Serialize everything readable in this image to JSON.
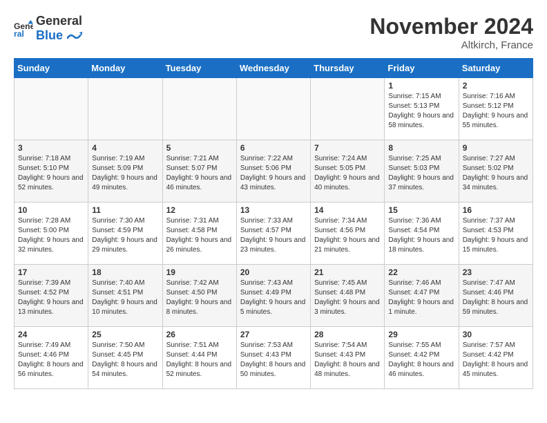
{
  "logo": {
    "line1": "General",
    "line2": "Blue"
  },
  "title": "November 2024",
  "subtitle": "Altkirch, France",
  "days_header": [
    "Sunday",
    "Monday",
    "Tuesday",
    "Wednesday",
    "Thursday",
    "Friday",
    "Saturday"
  ],
  "weeks": [
    [
      {
        "day": "",
        "info": ""
      },
      {
        "day": "",
        "info": ""
      },
      {
        "day": "",
        "info": ""
      },
      {
        "day": "",
        "info": ""
      },
      {
        "day": "",
        "info": ""
      },
      {
        "day": "1",
        "info": "Sunrise: 7:15 AM\nSunset: 5:13 PM\nDaylight: 9 hours and 58 minutes."
      },
      {
        "day": "2",
        "info": "Sunrise: 7:16 AM\nSunset: 5:12 PM\nDaylight: 9 hours and 55 minutes."
      }
    ],
    [
      {
        "day": "3",
        "info": "Sunrise: 7:18 AM\nSunset: 5:10 PM\nDaylight: 9 hours and 52 minutes."
      },
      {
        "day": "4",
        "info": "Sunrise: 7:19 AM\nSunset: 5:09 PM\nDaylight: 9 hours and 49 minutes."
      },
      {
        "day": "5",
        "info": "Sunrise: 7:21 AM\nSunset: 5:07 PM\nDaylight: 9 hours and 46 minutes."
      },
      {
        "day": "6",
        "info": "Sunrise: 7:22 AM\nSunset: 5:06 PM\nDaylight: 9 hours and 43 minutes."
      },
      {
        "day": "7",
        "info": "Sunrise: 7:24 AM\nSunset: 5:05 PM\nDaylight: 9 hours and 40 minutes."
      },
      {
        "day": "8",
        "info": "Sunrise: 7:25 AM\nSunset: 5:03 PM\nDaylight: 9 hours and 37 minutes."
      },
      {
        "day": "9",
        "info": "Sunrise: 7:27 AM\nSunset: 5:02 PM\nDaylight: 9 hours and 34 minutes."
      }
    ],
    [
      {
        "day": "10",
        "info": "Sunrise: 7:28 AM\nSunset: 5:00 PM\nDaylight: 9 hours and 32 minutes."
      },
      {
        "day": "11",
        "info": "Sunrise: 7:30 AM\nSunset: 4:59 PM\nDaylight: 9 hours and 29 minutes."
      },
      {
        "day": "12",
        "info": "Sunrise: 7:31 AM\nSunset: 4:58 PM\nDaylight: 9 hours and 26 minutes."
      },
      {
        "day": "13",
        "info": "Sunrise: 7:33 AM\nSunset: 4:57 PM\nDaylight: 9 hours and 23 minutes."
      },
      {
        "day": "14",
        "info": "Sunrise: 7:34 AM\nSunset: 4:56 PM\nDaylight: 9 hours and 21 minutes."
      },
      {
        "day": "15",
        "info": "Sunrise: 7:36 AM\nSunset: 4:54 PM\nDaylight: 9 hours and 18 minutes."
      },
      {
        "day": "16",
        "info": "Sunrise: 7:37 AM\nSunset: 4:53 PM\nDaylight: 9 hours and 15 minutes."
      }
    ],
    [
      {
        "day": "17",
        "info": "Sunrise: 7:39 AM\nSunset: 4:52 PM\nDaylight: 9 hours and 13 minutes."
      },
      {
        "day": "18",
        "info": "Sunrise: 7:40 AM\nSunset: 4:51 PM\nDaylight: 9 hours and 10 minutes."
      },
      {
        "day": "19",
        "info": "Sunrise: 7:42 AM\nSunset: 4:50 PM\nDaylight: 9 hours and 8 minutes."
      },
      {
        "day": "20",
        "info": "Sunrise: 7:43 AM\nSunset: 4:49 PM\nDaylight: 9 hours and 5 minutes."
      },
      {
        "day": "21",
        "info": "Sunrise: 7:45 AM\nSunset: 4:48 PM\nDaylight: 9 hours and 3 minutes."
      },
      {
        "day": "22",
        "info": "Sunrise: 7:46 AM\nSunset: 4:47 PM\nDaylight: 9 hours and 1 minute."
      },
      {
        "day": "23",
        "info": "Sunrise: 7:47 AM\nSunset: 4:46 PM\nDaylight: 8 hours and 59 minutes."
      }
    ],
    [
      {
        "day": "24",
        "info": "Sunrise: 7:49 AM\nSunset: 4:46 PM\nDaylight: 8 hours and 56 minutes."
      },
      {
        "day": "25",
        "info": "Sunrise: 7:50 AM\nSunset: 4:45 PM\nDaylight: 8 hours and 54 minutes."
      },
      {
        "day": "26",
        "info": "Sunrise: 7:51 AM\nSunset: 4:44 PM\nDaylight: 8 hours and 52 minutes."
      },
      {
        "day": "27",
        "info": "Sunrise: 7:53 AM\nSunset: 4:43 PM\nDaylight: 8 hours and 50 minutes."
      },
      {
        "day": "28",
        "info": "Sunrise: 7:54 AM\nSunset: 4:43 PM\nDaylight: 8 hours and 48 minutes."
      },
      {
        "day": "29",
        "info": "Sunrise: 7:55 AM\nSunset: 4:42 PM\nDaylight: 8 hours and 46 minutes."
      },
      {
        "day": "30",
        "info": "Sunrise: 7:57 AM\nSunset: 4:42 PM\nDaylight: 8 hours and 45 minutes."
      }
    ]
  ]
}
